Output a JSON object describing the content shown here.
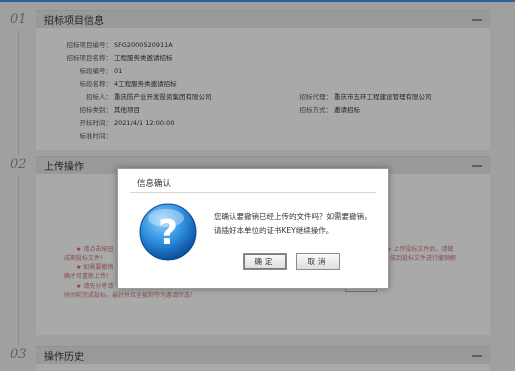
{
  "sections": [
    {
      "num": "01",
      "title": "招标项目信息"
    },
    {
      "num": "02",
      "title": "上传操作"
    },
    {
      "num": "03",
      "title": "操作历史"
    }
  ],
  "info": {
    "project_no_label": "招标项目编号：",
    "project_no": "SFG2000520911A",
    "project_name_label": "招标项目名称：",
    "project_name": "工程服务类邀请招标",
    "lot_no_label": "标段编号：",
    "lot_no": "01",
    "lot_name_label": "标段名称：",
    "lot_name": "4工程服务类邀请招标",
    "tenderer_label": "招标人：",
    "tenderer": "重庆防产业开发投资集团有限公司",
    "agency_label": "招标代理：",
    "agency": "重庆市五环工程建设管理有限公司",
    "category_label": "招标类别：",
    "category": "其他项目",
    "method_label": "招标方式：",
    "method": "邀请招标",
    "open_time_label": "开标时间：",
    "open_time": "2021/4/1 12:00:00",
    "bid_time_label": "标准时间：",
    "bid_time": ""
  },
  "notes_left": [
    "请点击按钮",
    "成期投标文件！",
    "如需要撤销",
    "确才可重新上传！",
    "请先分考请",
    "时间前完成投标，最好并且全被剥夺为邀请所选！"
  ],
  "notes_right": [
    "上传投标文件后，请做",
    "成到投标文件进行撤销解"
  ],
  "dialog": {
    "title": "信息确认",
    "message_line1": "您确认要撤销已经上传的文件吗？如需要撤销，",
    "message_line2": "请插好本单位的证书KEY继续操作。",
    "ok_label": "确定",
    "cancel_label": "取消"
  }
}
